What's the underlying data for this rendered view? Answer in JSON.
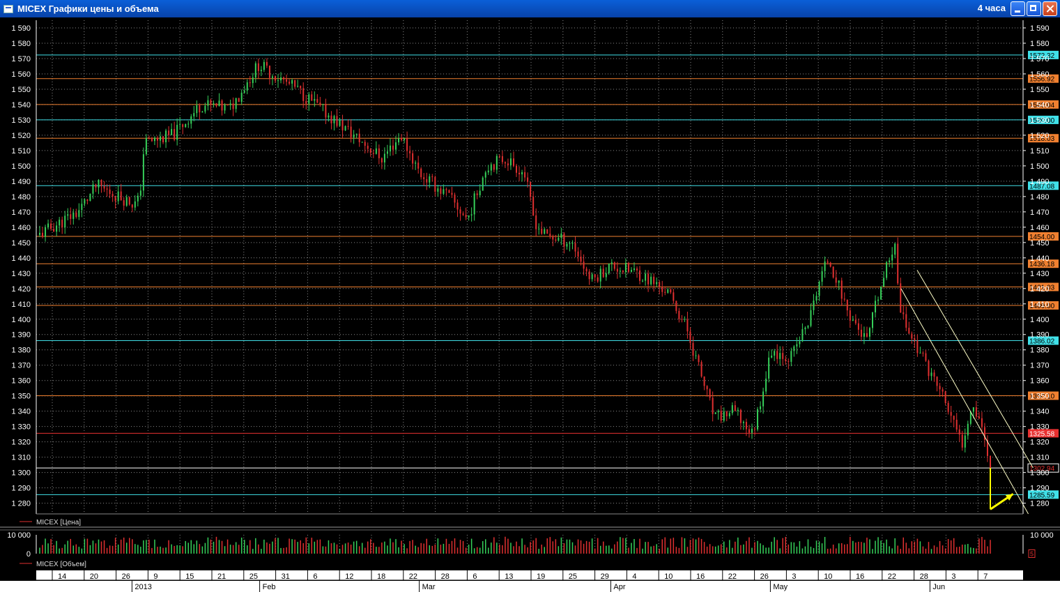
{
  "window": {
    "title": "MICEX Графики цены и объема",
    "timeframe": "4 часа"
  },
  "legend": {
    "price": "MICEX [Цена]",
    "volume": "MICEX [Объем]"
  },
  "colors": {
    "up": "#36d05a",
    "down": "#e03030",
    "grid": "#8a8a8a",
    "cyan_level": "#40e0e8",
    "orange_level": "#f08030",
    "red_level": "#e83030",
    "white_level": "#ffffff",
    "channel": "#ffffc8",
    "arrow": "#ffff00"
  },
  "chart_data": [
    {
      "type": "candlestick",
      "ylim": [
        1273,
        1595
      ],
      "yticks": [
        1280,
        1290,
        1300,
        1310,
        1320,
        1330,
        1340,
        1350,
        1360,
        1370,
        1380,
        1390,
        1400,
        1410,
        1420,
        1430,
        1440,
        1450,
        1460,
        1470,
        1480,
        1490,
        1500,
        1510,
        1520,
        1530,
        1540,
        1550,
        1560,
        1570,
        1580,
        1590
      ],
      "ytick_format": "space-thousands",
      "x_dates": [
        "14",
        "20",
        "26",
        "9",
        "15",
        "21",
        "25",
        "31",
        "6",
        "12",
        "18",
        "22",
        "28",
        "6",
        "13",
        "19",
        "25",
        "29",
        "4",
        "10",
        "16",
        "22",
        "26",
        "3",
        "10",
        "16",
        "22",
        "28",
        "3",
        "7"
      ],
      "x_months": [
        "2013",
        "Feb",
        "Mar",
        "Apr",
        "May",
        "Jun"
      ],
      "key_points": [
        {
          "t": 0,
          "close": 1455
        },
        {
          "t": 0.04,
          "close": 1470
        },
        {
          "t": 0.06,
          "close": 1487
        },
        {
          "t": 0.1,
          "close": 1475
        },
        {
          "t": 0.105,
          "close": 1478
        },
        {
          "t": 0.11,
          "close": 1515
        },
        {
          "t": 0.14,
          "close": 1520
        },
        {
          "t": 0.17,
          "close": 1540
        },
        {
          "t": 0.2,
          "close": 1537
        },
        {
          "t": 0.23,
          "close": 1566
        },
        {
          "t": 0.27,
          "close": 1550
        },
        {
          "t": 0.3,
          "close": 1535
        },
        {
          "t": 0.33,
          "close": 1520
        },
        {
          "t": 0.36,
          "close": 1505
        },
        {
          "t": 0.38,
          "close": 1520
        },
        {
          "t": 0.4,
          "close": 1495
        },
        {
          "t": 0.43,
          "close": 1480
        },
        {
          "t": 0.45,
          "close": 1465
        },
        {
          "t": 0.47,
          "close": 1500
        },
        {
          "t": 0.49,
          "close": 1505
        },
        {
          "t": 0.51,
          "close": 1495
        },
        {
          "t": 0.52,
          "close": 1465
        },
        {
          "t": 0.53,
          "close": 1455
        },
        {
          "t": 0.56,
          "close": 1450
        },
        {
          "t": 0.58,
          "close": 1425
        },
        {
          "t": 0.6,
          "close": 1435
        },
        {
          "t": 0.63,
          "close": 1430
        },
        {
          "t": 0.66,
          "close": 1418
        },
        {
          "t": 0.68,
          "close": 1395
        },
        {
          "t": 0.71,
          "close": 1335
        },
        {
          "t": 0.73,
          "close": 1340
        },
        {
          "t": 0.75,
          "close": 1325
        },
        {
          "t": 0.77,
          "close": 1380
        },
        {
          "t": 0.79,
          "close": 1375
        },
        {
          "t": 0.81,
          "close": 1400
        },
        {
          "t": 0.82,
          "close": 1425
        },
        {
          "t": 0.83,
          "close": 1440
        },
        {
          "t": 0.85,
          "close": 1405
        },
        {
          "t": 0.87,
          "close": 1385
        },
        {
          "t": 0.88,
          "close": 1410
        },
        {
          "t": 0.9,
          "close": 1452
        },
        {
          "t": 0.905,
          "close": 1405
        },
        {
          "t": 0.92,
          "close": 1385
        },
        {
          "t": 0.95,
          "close": 1350
        },
        {
          "t": 0.97,
          "close": 1318
        },
        {
          "t": 0.98,
          "close": 1345
        },
        {
          "t": 0.99,
          "close": 1335
        },
        {
          "t": 1.0,
          "close": 1300
        }
      ],
      "levels": [
        {
          "value": 1572.32,
          "label": "1572.32",
          "style": "cyan_level"
        },
        {
          "value": 1556.92,
          "label": "1556.92",
          "style": "orange_level"
        },
        {
          "value": 1540.04,
          "label": "1540.04",
          "style": "orange_level"
        },
        {
          "value": 1530.0,
          "label": "1530.00",
          "style": "cyan_level"
        },
        {
          "value": 1518.03,
          "label": "1518.03",
          "style": "orange_level"
        },
        {
          "value": 1487.08,
          "label": "1487.08",
          "style": "cyan_level"
        },
        {
          "value": 1454.0,
          "label": "1454.00",
          "style": "orange_level"
        },
        {
          "value": 1436.18,
          "label": "1436.18",
          "style": "orange_level"
        },
        {
          "value": 1421.03,
          "label": "1421.03",
          "style": "orange_level"
        },
        {
          "value": 1409.0,
          "label": "1409.00",
          "style": "orange_level"
        },
        {
          "value": 1386.02,
          "label": "1386.02",
          "style": "cyan_level"
        },
        {
          "value": 1350.1,
          "label": "1350.10",
          "style": "orange_level"
        },
        {
          "value": 1325.58,
          "label": "1325.58",
          "style": "red_level"
        },
        {
          "value": 1302.94,
          "label": "1302.94",
          "style": "white_level"
        },
        {
          "value": 1285.59,
          "label": "1285.59",
          "style": "cyan_level"
        }
      ],
      "channel": [
        {
          "from": {
            "t": 0.906,
            "value": 1420
          },
          "to": {
            "t": 1.04,
            "value": 1273
          }
        },
        {
          "from": {
            "t": 0.923,
            "value": 1432
          },
          "to": {
            "t": 1.045,
            "value": 1303
          }
        }
      ],
      "arrow": {
        "down": {
          "from": {
            "t": 1.0,
            "value": 1303
          },
          "to": {
            "t": 1.0,
            "value": 1276
          }
        },
        "up": {
          "from": {
            "t": 1.0,
            "value": 1276
          },
          "to": {
            "t": 1.024,
            "value": 1286
          }
        }
      }
    },
    {
      "type": "bar",
      "title": "volume",
      "ylim": [
        0,
        10000
      ],
      "yticks": [
        0,
        10000
      ],
      "yticks_labels": [
        "0",
        "10 000"
      ],
      "current_label": "5"
    }
  ]
}
